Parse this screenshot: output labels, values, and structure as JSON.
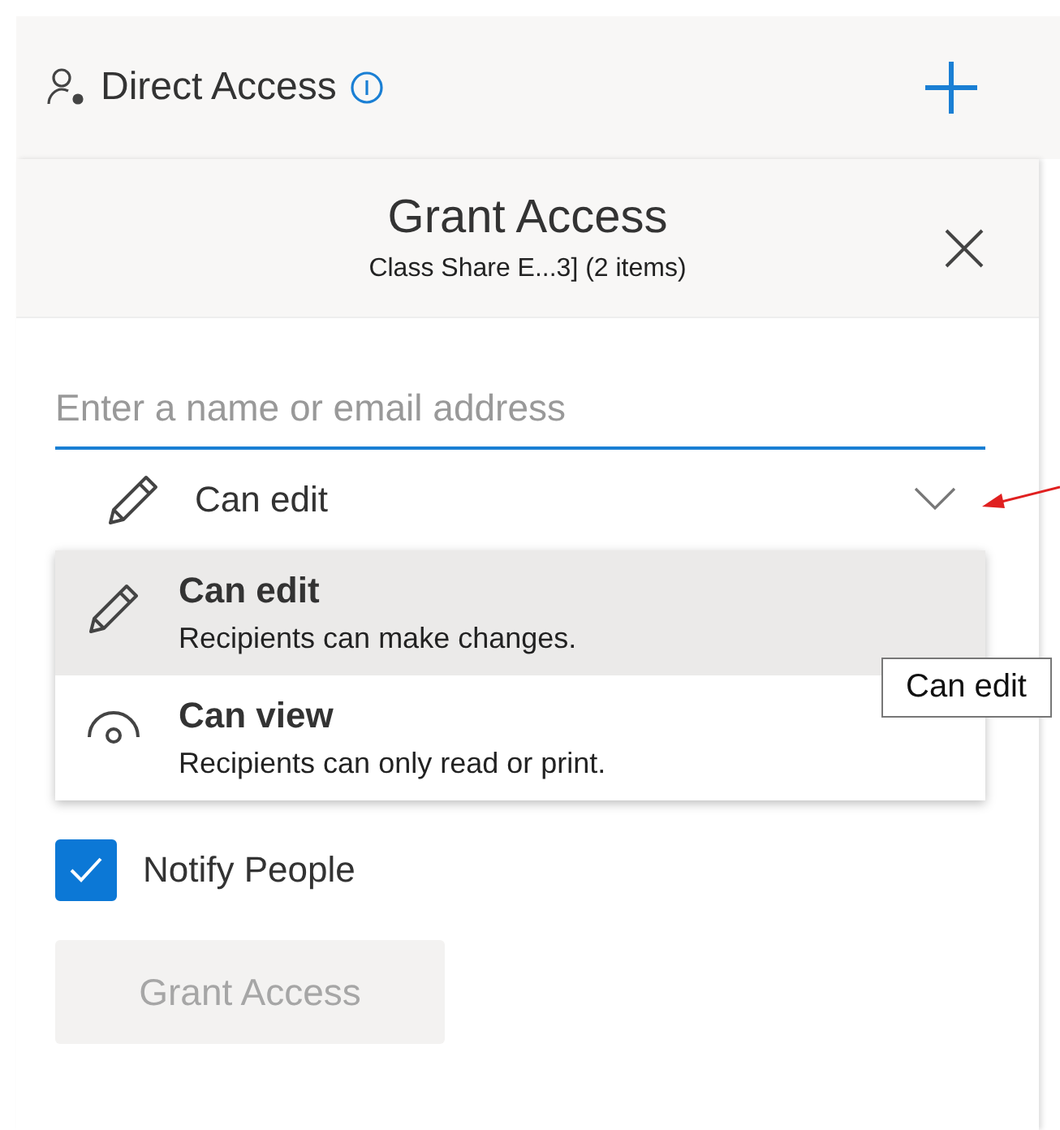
{
  "header": {
    "title": "Direct Access"
  },
  "panel": {
    "title": "Grant Access",
    "subtitle": "Class Share E...3] (2 items)"
  },
  "recipient_field": {
    "placeholder": "Enter a name or email address"
  },
  "permission": {
    "value": "Can edit",
    "kind": "edit",
    "expanded": true
  },
  "permission_options": [
    {
      "kind": "edit",
      "label": "Can edit",
      "description": "Recipients can make changes.",
      "selected": true
    },
    {
      "kind": "view",
      "label": "Can view",
      "description": "Recipients can only read or print.",
      "selected": false
    }
  ],
  "tooltip": "Can edit",
  "notify": {
    "label": "Notify People",
    "checked": true
  },
  "grant_button": {
    "label": "Grant Access",
    "disabled": true
  }
}
